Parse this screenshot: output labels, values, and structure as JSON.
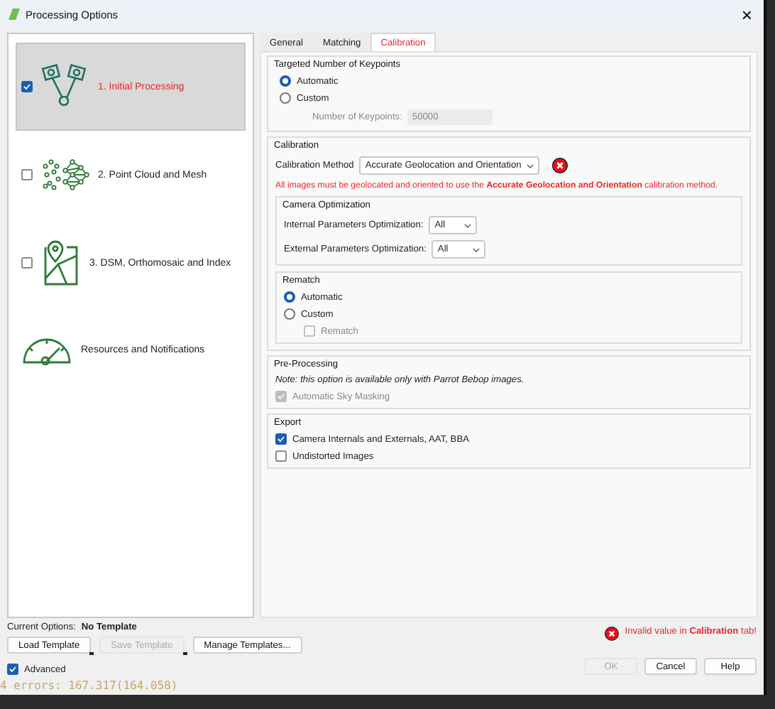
{
  "window": {
    "title": "Processing Options",
    "close": "×"
  },
  "steps": [
    {
      "label": "1. Initial Processing",
      "kind": "cameras",
      "checked": true,
      "selected": true
    },
    {
      "label": "2. Point Cloud and Mesh",
      "kind": "points",
      "checked": false,
      "selected": false
    },
    {
      "label": "3. DSM, Orthomosaic and Index",
      "kind": "map",
      "checked": false,
      "selected": false
    },
    {
      "label": "Resources and Notifications",
      "kind": "gauge",
      "selected": false
    }
  ],
  "tabs": [
    {
      "label": "General",
      "selected": false,
      "error": false
    },
    {
      "label": "Matching",
      "selected": false,
      "error": false
    },
    {
      "label": "Calibration",
      "selected": true,
      "error": true
    }
  ],
  "keypoints": {
    "title": "Targeted Number of Keypoints",
    "options": [
      {
        "label": "Automatic",
        "selected": true
      },
      {
        "label": "Custom",
        "selected": false
      }
    ],
    "field_label": "Number of Keypoints:",
    "field_value": "50000",
    "disabled": true
  },
  "calibration": {
    "title": "Calibration",
    "method_label": "Calibration Method",
    "method_value": "Accurate Geolocation and Orientation",
    "error": true,
    "message": "All images must be geolocated and oriented to use the **Accurate Geolocation and Orientation** calibration method.",
    "camera": {
      "title": "Camera Optimization",
      "rows": [
        {
          "label": "Internal Parameters Optimization:",
          "value": "All"
        },
        {
          "label": "External Parameters Optimization:",
          "value": "All"
        }
      ]
    },
    "rematch": {
      "title": "Rematch",
      "options": [
        {
          "label": "Automatic",
          "selected": true
        },
        {
          "label": "Custom",
          "selected": false
        }
      ],
      "checkbox": {
        "label": "Rematch",
        "checked": false,
        "disabled": true
      }
    }
  },
  "preprocessing": {
    "title": "Pre-Processing",
    "note": "Note: this option is available only with Parrot Bebop images.",
    "checkbox": {
      "label": "Automatic Sky Masking",
      "checked": true,
      "disabled": true
    }
  },
  "export": {
    "title": "Export",
    "checkboxes": [
      {
        "label": "Camera Internals and Externals, AAT, BBA",
        "checked": true,
        "disabled": false
      },
      {
        "label": "Undistorted Images",
        "checked": false,
        "disabled": false
      }
    ]
  },
  "footer": {
    "current_label": "Current Options:",
    "current_value": "No Template",
    "template_buttons": [
      {
        "label": "Load Template",
        "disabled": false,
        "menu": true
      },
      {
        "label": "Save Template",
        "disabled": true,
        "menu": true
      },
      {
        "label": "Manage Templates...",
        "disabled": false,
        "menu": false
      }
    ],
    "advanced": {
      "label": "Advanced",
      "checked": true
    },
    "error": "Invalid value in **Calibration** tab!",
    "buttons": [
      {
        "label": "OK",
        "disabled": true
      },
      {
        "label": "Cancel",
        "disabled": false
      },
      {
        "label": "Help",
        "disabled": false
      }
    ]
  },
  "background_text": "4 errors: 167.317(164.058)"
}
